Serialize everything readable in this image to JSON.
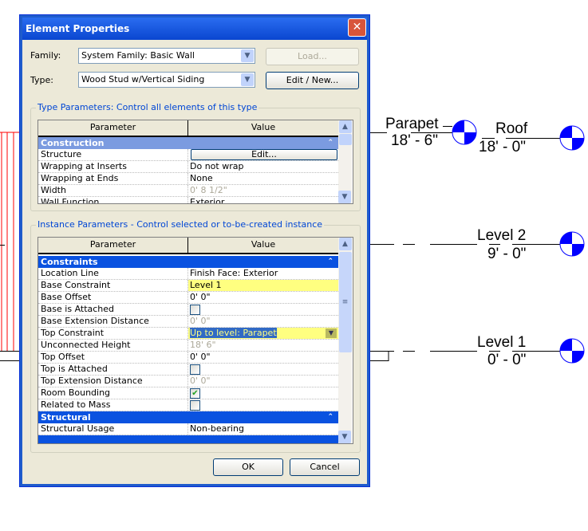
{
  "dialog": {
    "title": "Element Properties",
    "family_label": "Family:",
    "family_value": "System Family: Basic Wall",
    "type_label": "Type:",
    "type_value": "Wood Stud w/Vertical Siding",
    "load_button": "Load...",
    "edit_new_button": "Edit / New...",
    "ok_button": "OK",
    "cancel_button": "Cancel"
  },
  "type_params": {
    "caption": "Type Parameters: Control all elements of this type",
    "col_param": "Parameter",
    "col_value": "Value",
    "section": "Construction",
    "section_color": "#7b9be0",
    "rows": [
      {
        "p": "Structure",
        "v": "Edit...",
        "kind": "button"
      },
      {
        "p": "Wrapping at Inserts",
        "v": "Do not wrap"
      },
      {
        "p": "Wrapping at Ends",
        "v": "None"
      },
      {
        "p": "Width",
        "v": "0'  8 1/2\"",
        "kind": "gray"
      },
      {
        "p": "Wall Function",
        "v": "Exterior"
      }
    ]
  },
  "instance_params": {
    "caption": "Instance Parameters - Control selected or to-be-created instance",
    "col_param": "Parameter",
    "col_value": "Value",
    "section_color": "#0a52e0",
    "highlight_color": "#ffff80",
    "sections": [
      {
        "name": "Constraints",
        "rows": [
          {
            "p": "Location Line",
            "v": "Finish Face: Exterior"
          },
          {
            "p": "Base Constraint",
            "v": "Level 1",
            "kind": "highlight"
          },
          {
            "p": "Base Offset",
            "v": "0'  0\""
          },
          {
            "p": "Base is Attached",
            "kind": "check",
            "checked": false
          },
          {
            "p": "Base Extension Distance",
            "v": "0'  0\"",
            "kind": "gray"
          },
          {
            "p": "Top Constraint",
            "v": "Up to level: Parapet",
            "kind": "dropdown"
          },
          {
            "p": "Unconnected Height",
            "v": "18'  6\"",
            "kind": "gray"
          },
          {
            "p": "Top Offset",
            "v": "0'  0\""
          },
          {
            "p": "Top is Attached",
            "kind": "check",
            "checked": false
          },
          {
            "p": "Top Extension Distance",
            "v": "0'  0\"",
            "kind": "gray"
          },
          {
            "p": "Room Bounding",
            "kind": "check",
            "checked": true
          },
          {
            "p": "Related to Mass",
            "kind": "check",
            "checked": false
          }
        ]
      },
      {
        "name": "Structural",
        "rows": [
          {
            "p": "Structural Usage",
            "v": "Non-bearing"
          }
        ]
      }
    ]
  },
  "levels": [
    {
      "name": "Parapet",
      "elev": "18' - 6\""
    },
    {
      "name": "Roof",
      "elev": "18' - 0\""
    },
    {
      "name": "Level 2",
      "elev": "9' - 0\""
    },
    {
      "name": "Level 1",
      "elev": "0' - 0\""
    }
  ],
  "colors": {
    "level_head": "#0000ff",
    "wall": "#ff0000"
  }
}
